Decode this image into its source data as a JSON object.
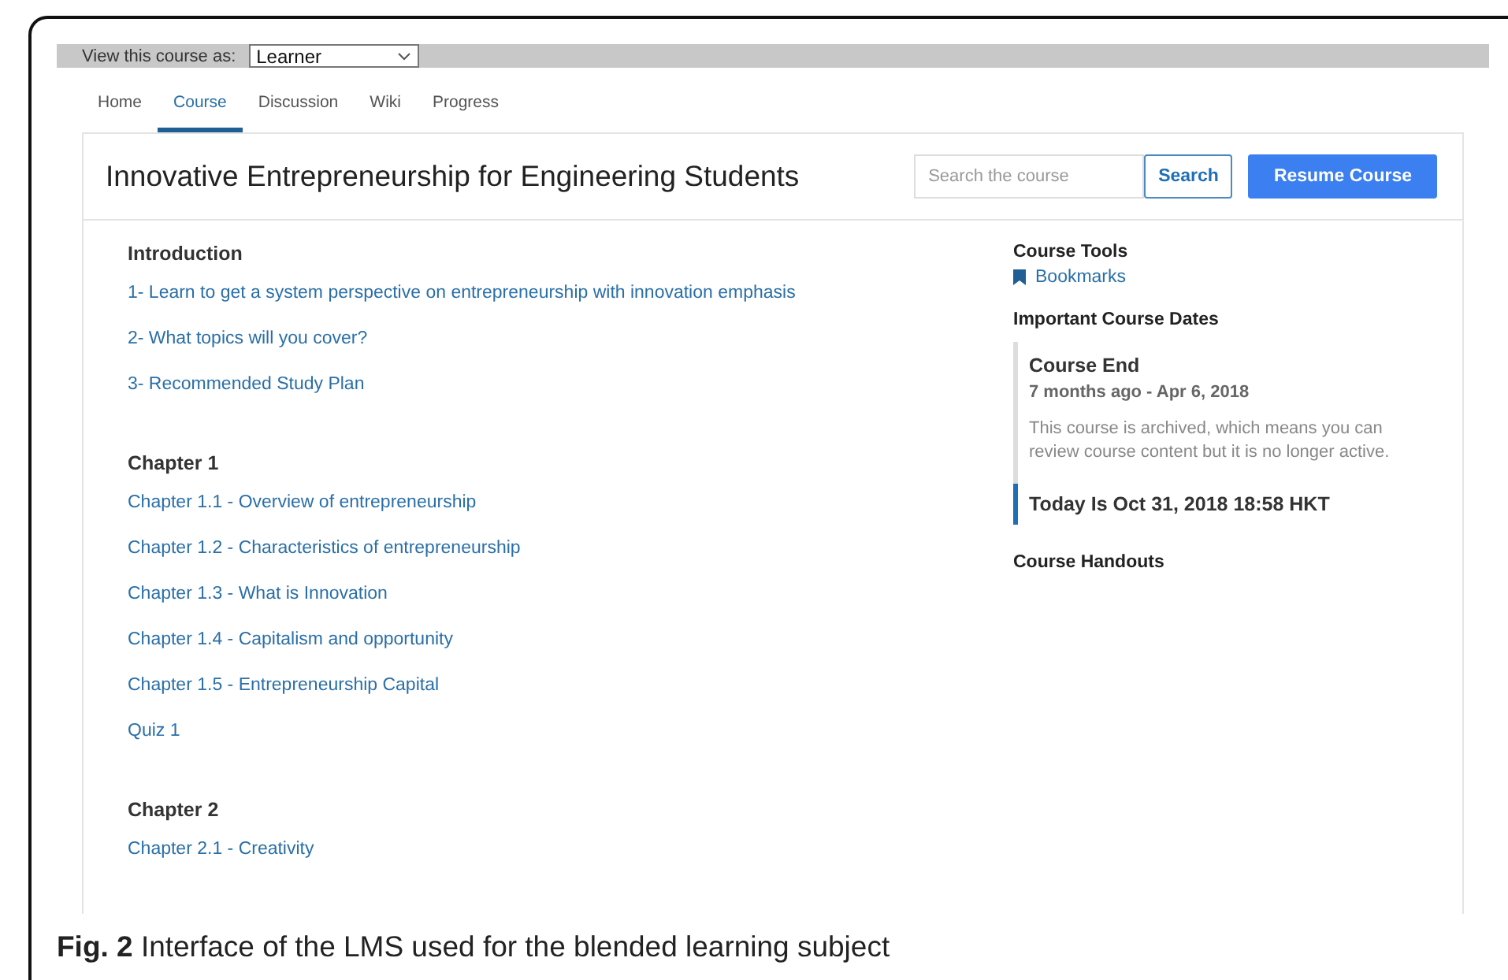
{
  "view_as": {
    "label": "View this course as:",
    "value": "Learner"
  },
  "tabs": [
    {
      "label": "Home",
      "selected": false
    },
    {
      "label": "Course",
      "selected": true
    },
    {
      "label": "Discussion",
      "selected": false
    },
    {
      "label": "Wiki",
      "selected": false
    },
    {
      "label": "Progress",
      "selected": false
    }
  ],
  "course": {
    "title": "Innovative Entrepreneurship for Engineering Students",
    "search": {
      "placeholder": "Search the course",
      "button": "Search"
    },
    "resume_button": "Resume Course"
  },
  "outline": [
    {
      "heading": "Introduction",
      "links": [
        "1- Learn to get a system perspective on entrepreneurship with innovation emphasis",
        "2- What topics will you cover?",
        "3- Recommended Study Plan"
      ]
    },
    {
      "heading": "Chapter 1",
      "links": [
        "Chapter 1.1 - Overview of entrepreneurship",
        "Chapter 1.2 - Characteristics of entrepreneurship",
        "Chapter 1.3 - What is Innovation",
        "Chapter 1.4 - Capitalism and opportunity",
        "Chapter 1.5 - Entrepreneurship Capital",
        "Quiz 1"
      ]
    },
    {
      "heading": "Chapter 2",
      "links": [
        "Chapter 2.1 - Creativity"
      ]
    }
  ],
  "sidebar": {
    "tools_heading": "Course Tools",
    "tools": [
      "Bookmarks"
    ],
    "dates_heading": "Important Course Dates",
    "dates": [
      {
        "title": "Course End",
        "when": "7 months ago - Apr 6, 2018",
        "note": "This course is archived, which means you can review course content but it is no longer active.",
        "current": false
      },
      {
        "title": "Today Is Oct 31, 2018 18:58 HKT",
        "current": true
      }
    ],
    "handouts_heading": "Course Handouts"
  },
  "caption": "**Fig. 2** Interface of the LMS used for the blended learning subject"
}
